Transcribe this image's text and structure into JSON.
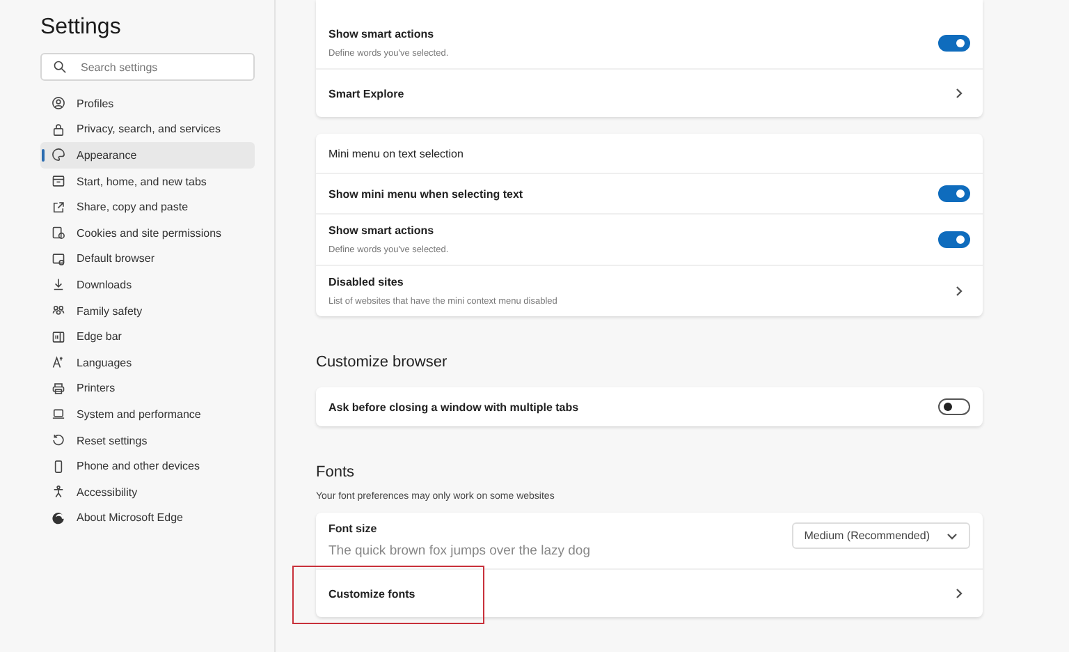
{
  "sidebar": {
    "title": "Settings",
    "search": {
      "placeholder": "Search settings"
    },
    "items": [
      {
        "label": "Profiles",
        "selected": false
      },
      {
        "label": "Privacy, search, and services",
        "selected": false
      },
      {
        "label": "Appearance",
        "selected": true
      },
      {
        "label": "Start, home, and new tabs",
        "selected": false
      },
      {
        "label": "Share, copy and paste",
        "selected": false
      },
      {
        "label": "Cookies and site permissions",
        "selected": false
      },
      {
        "label": "Default browser",
        "selected": false
      },
      {
        "label": "Downloads",
        "selected": false
      },
      {
        "label": "Family safety",
        "selected": false
      },
      {
        "label": "Edge bar",
        "selected": false
      },
      {
        "label": "Languages",
        "selected": false
      },
      {
        "label": "Printers",
        "selected": false
      },
      {
        "label": "System and performance",
        "selected": false
      },
      {
        "label": "Reset settings",
        "selected": false
      },
      {
        "label": "Phone and other devices",
        "selected": false
      },
      {
        "label": "Accessibility",
        "selected": false
      },
      {
        "label": "About Microsoft Edge",
        "selected": false
      }
    ]
  },
  "main": [
    {
      "kind": "card",
      "rows": [
        {
          "kind": "toggle",
          "label": "Show smart actions",
          "description": "Define words you've selected.",
          "on": true
        },
        {
          "kind": "link",
          "label": "Smart Explore"
        }
      ]
    },
    {
      "kind": "card",
      "rows": [
        {
          "kind": "header",
          "label": "Mini menu on text selection"
        },
        {
          "kind": "toggle",
          "label": "Show mini menu when selecting text",
          "on": true
        },
        {
          "kind": "toggle",
          "label": "Show smart actions",
          "description": "Define words you've selected.",
          "on": true
        },
        {
          "kind": "link",
          "label": "Disabled sites",
          "description": "List of websites that have the mini context menu disabled"
        }
      ]
    },
    {
      "kind": "heading",
      "text": "Customize browser"
    },
    {
      "kind": "card",
      "rows": [
        {
          "kind": "toggle",
          "label": "Ask before closing a window with multiple tabs",
          "on": false
        }
      ]
    },
    {
      "kind": "heading",
      "text": "Fonts"
    },
    {
      "kind": "note",
      "text": "Your font preferences may only work on some websites"
    },
    {
      "kind": "card",
      "rows": [
        {
          "kind": "select",
          "label": "Font size",
          "description": "The quick brown fox jumps over the lazy dog",
          "value": "Medium (Recommended)"
        },
        {
          "kind": "link",
          "label": "Customize fonts",
          "highlighted": true
        }
      ]
    }
  ]
}
